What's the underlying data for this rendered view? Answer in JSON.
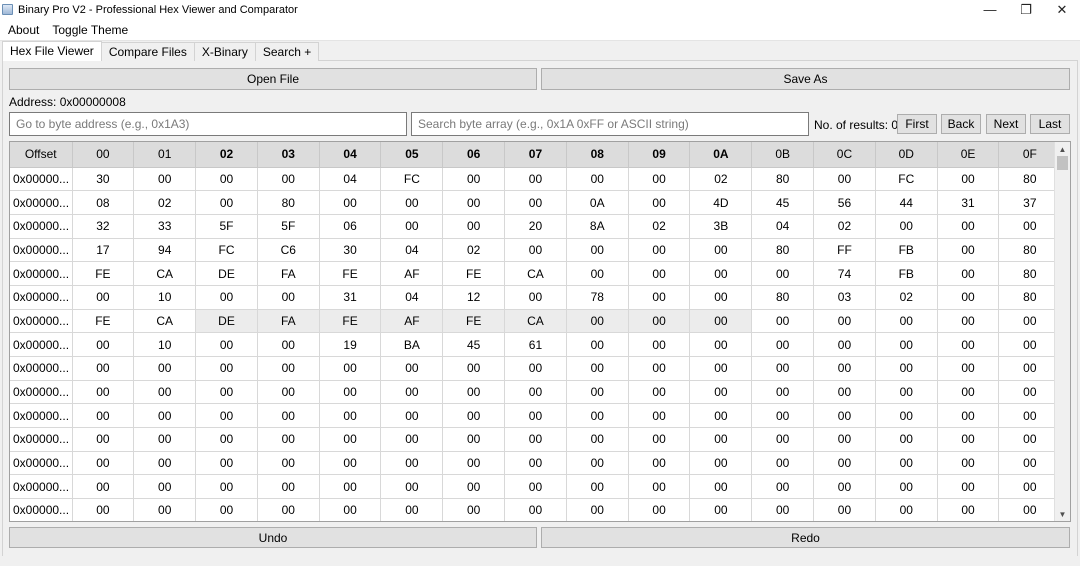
{
  "window": {
    "title": "Binary Pro V2 - Professional Hex Viewer and Comparator",
    "minimize_glyph": "—",
    "maximize_glyph": "❐",
    "close_glyph": "✕"
  },
  "menu": [
    "About",
    "Toggle Theme"
  ],
  "tabs": [
    {
      "label": "Hex File Viewer",
      "active": true
    },
    {
      "label": "Compare Files",
      "active": false
    },
    {
      "label": "X-Binary",
      "active": false
    },
    {
      "label": "Search +",
      "active": false
    }
  ],
  "toolbar": {
    "open_label": "Open File",
    "save_label": "Save As"
  },
  "address": {
    "text": "Address: 0x00000008"
  },
  "goto": {
    "placeholder": "Go to byte address (e.g., 0x1A3)",
    "value": ""
  },
  "search": {
    "placeholder": "Search byte array (e.g., 0x1A 0xFF or ASCII string)",
    "value": "",
    "results_label": "No. of results: 0",
    "first_label": "First",
    "back_label": "Back",
    "next_label": "Next",
    "last_label": "Last"
  },
  "grid": {
    "columns": [
      "Offset",
      "00",
      "01",
      "02",
      "03",
      "04",
      "05",
      "06",
      "07",
      "08",
      "09",
      "0A",
      "0B",
      "0C",
      "0D",
      "0E",
      "0F"
    ],
    "bold_columns": [
      "02",
      "03",
      "04",
      "05",
      "06",
      "07",
      "08",
      "09",
      "0A"
    ],
    "rows": [
      {
        "offset": "0x00000...",
        "bytes": [
          "30",
          "00",
          "00",
          "00",
          "04",
          "FC",
          "00",
          "00",
          "00",
          "00",
          "02",
          "80",
          "00",
          "FC",
          "00",
          "80"
        ]
      },
      {
        "offset": "0x00000...",
        "bytes": [
          "08",
          "02",
          "00",
          "80",
          "00",
          "00",
          "00",
          "00",
          "0A",
          "00",
          "4D",
          "45",
          "56",
          "44",
          "31",
          "37"
        ]
      },
      {
        "offset": "0x00000...",
        "bytes": [
          "32",
          "33",
          "5F",
          "5F",
          "06",
          "00",
          "00",
          "20",
          "8A",
          "02",
          "3B",
          "04",
          "02",
          "00",
          "00",
          "00"
        ]
      },
      {
        "offset": "0x00000...",
        "bytes": [
          "17",
          "94",
          "FC",
          "C6",
          "30",
          "04",
          "02",
          "00",
          "00",
          "00",
          "00",
          "80",
          "FF",
          "FB",
          "00",
          "80"
        ]
      },
      {
        "offset": "0x00000...",
        "bytes": [
          "FE",
          "CA",
          "DE",
          "FA",
          "FE",
          "AF",
          "FE",
          "CA",
          "00",
          "00",
          "00",
          "00",
          "74",
          "FB",
          "00",
          "80"
        ]
      },
      {
        "offset": "0x00000...",
        "bytes": [
          "00",
          "10",
          "00",
          "00",
          "31",
          "04",
          "12",
          "00",
          "78",
          "00",
          "00",
          "80",
          "03",
          "02",
          "00",
          "80"
        ]
      },
      {
        "offset": "0x00000...",
        "bytes": [
          "FE",
          "CA",
          "DE",
          "FA",
          "FE",
          "AF",
          "FE",
          "CA",
          "00",
          "00",
          "00",
          "00",
          "00",
          "00",
          "00",
          "00"
        ],
        "highlight_range": [
          2,
          10
        ]
      },
      {
        "offset": "0x00000...",
        "bytes": [
          "00",
          "10",
          "00",
          "00",
          "19",
          "BA",
          "45",
          "61",
          "00",
          "00",
          "00",
          "00",
          "00",
          "00",
          "00",
          "00"
        ]
      },
      {
        "offset": "0x00000...",
        "bytes": [
          "00",
          "00",
          "00",
          "00",
          "00",
          "00",
          "00",
          "00",
          "00",
          "00",
          "00",
          "00",
          "00",
          "00",
          "00",
          "00"
        ]
      },
      {
        "offset": "0x00000...",
        "bytes": [
          "00",
          "00",
          "00",
          "00",
          "00",
          "00",
          "00",
          "00",
          "00",
          "00",
          "00",
          "00",
          "00",
          "00",
          "00",
          "00"
        ]
      },
      {
        "offset": "0x00000...",
        "bytes": [
          "00",
          "00",
          "00",
          "00",
          "00",
          "00",
          "00",
          "00",
          "00",
          "00",
          "00",
          "00",
          "00",
          "00",
          "00",
          "00"
        ]
      },
      {
        "offset": "0x00000...",
        "bytes": [
          "00",
          "00",
          "00",
          "00",
          "00",
          "00",
          "00",
          "00",
          "00",
          "00",
          "00",
          "00",
          "00",
          "00",
          "00",
          "00"
        ]
      },
      {
        "offset": "0x00000...",
        "bytes": [
          "00",
          "00",
          "00",
          "00",
          "00",
          "00",
          "00",
          "00",
          "00",
          "00",
          "00",
          "00",
          "00",
          "00",
          "00",
          "00"
        ]
      },
      {
        "offset": "0x00000...",
        "bytes": [
          "00",
          "00",
          "00",
          "00",
          "00",
          "00",
          "00",
          "00",
          "00",
          "00",
          "00",
          "00",
          "00",
          "00",
          "00",
          "00"
        ]
      },
      {
        "offset": "0x00000...",
        "bytes": [
          "00",
          "00",
          "00",
          "00",
          "00",
          "00",
          "00",
          "00",
          "00",
          "00",
          "00",
          "00",
          "00",
          "00",
          "00",
          "00"
        ]
      }
    ]
  },
  "bottom": {
    "undo_label": "Undo",
    "redo_label": "Redo"
  },
  "icons": {
    "app": "app-window-icon",
    "scroll_up": "▲",
    "scroll_down": "▼"
  }
}
